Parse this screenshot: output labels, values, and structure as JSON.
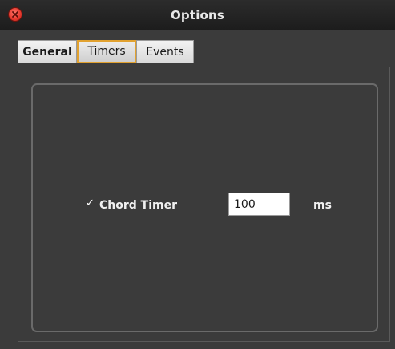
{
  "window": {
    "title": "Options"
  },
  "tabs": [
    {
      "label": "General",
      "active": false
    },
    {
      "label": "Timers",
      "active": true
    },
    {
      "label": "Events",
      "active": false
    }
  ],
  "timers": {
    "chord_timer": {
      "label": "Chord Timer",
      "checked": true,
      "check_glyph": "✓",
      "value": "100",
      "unit": "ms"
    }
  },
  "icons": {
    "close": "close-icon"
  },
  "colors": {
    "background": "#3b3b3b",
    "titlebar": "#1c1c1c",
    "close_red": "#e83a2f",
    "focus_ring": "#e2a230",
    "text_light": "#f0f0f0"
  }
}
